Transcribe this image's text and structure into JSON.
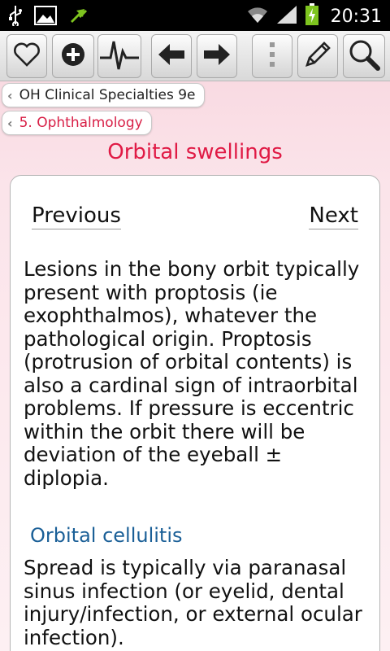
{
  "status_bar": {
    "time": "20:31",
    "icons": [
      "usb-icon",
      "picture-icon",
      "sync-icon",
      "wifi-icon",
      "signal-icon",
      "battery-charging-icon"
    ]
  },
  "toolbar": {
    "buttons": [
      "favorite-button",
      "add-button",
      "vital-signs-button",
      "back-button",
      "forward-button",
      "menu-button",
      "edit-button",
      "search-button"
    ]
  },
  "breadcrumbs": [
    {
      "label": "OH Clinical Specialties 9e"
    },
    {
      "label": "5. Ophthalmology"
    }
  ],
  "page": {
    "title": "Orbital swellings",
    "nav": {
      "previous": "Previous",
      "next": "Next"
    },
    "paragraph1": "Lesions in the bony orbit typically present with proptosis (ie exophthalmos), whatever the pathological origin. Proptosis (protrusion of orbital contents) is also a cardinal sign of intraorbital problems. If pressure is eccentric within the orbit there will be deviation of the eyeball ± diplopia.",
    "section_heading": "Orbital cellulitis",
    "paragraph2": "Spread is typically via paranasal sinus infection (or eyelid, dental injury/infection, or external ocular infection)."
  },
  "colors": {
    "title": "#e01a45",
    "heading": "#1a5f97",
    "crumb_active": "#d81f46"
  }
}
